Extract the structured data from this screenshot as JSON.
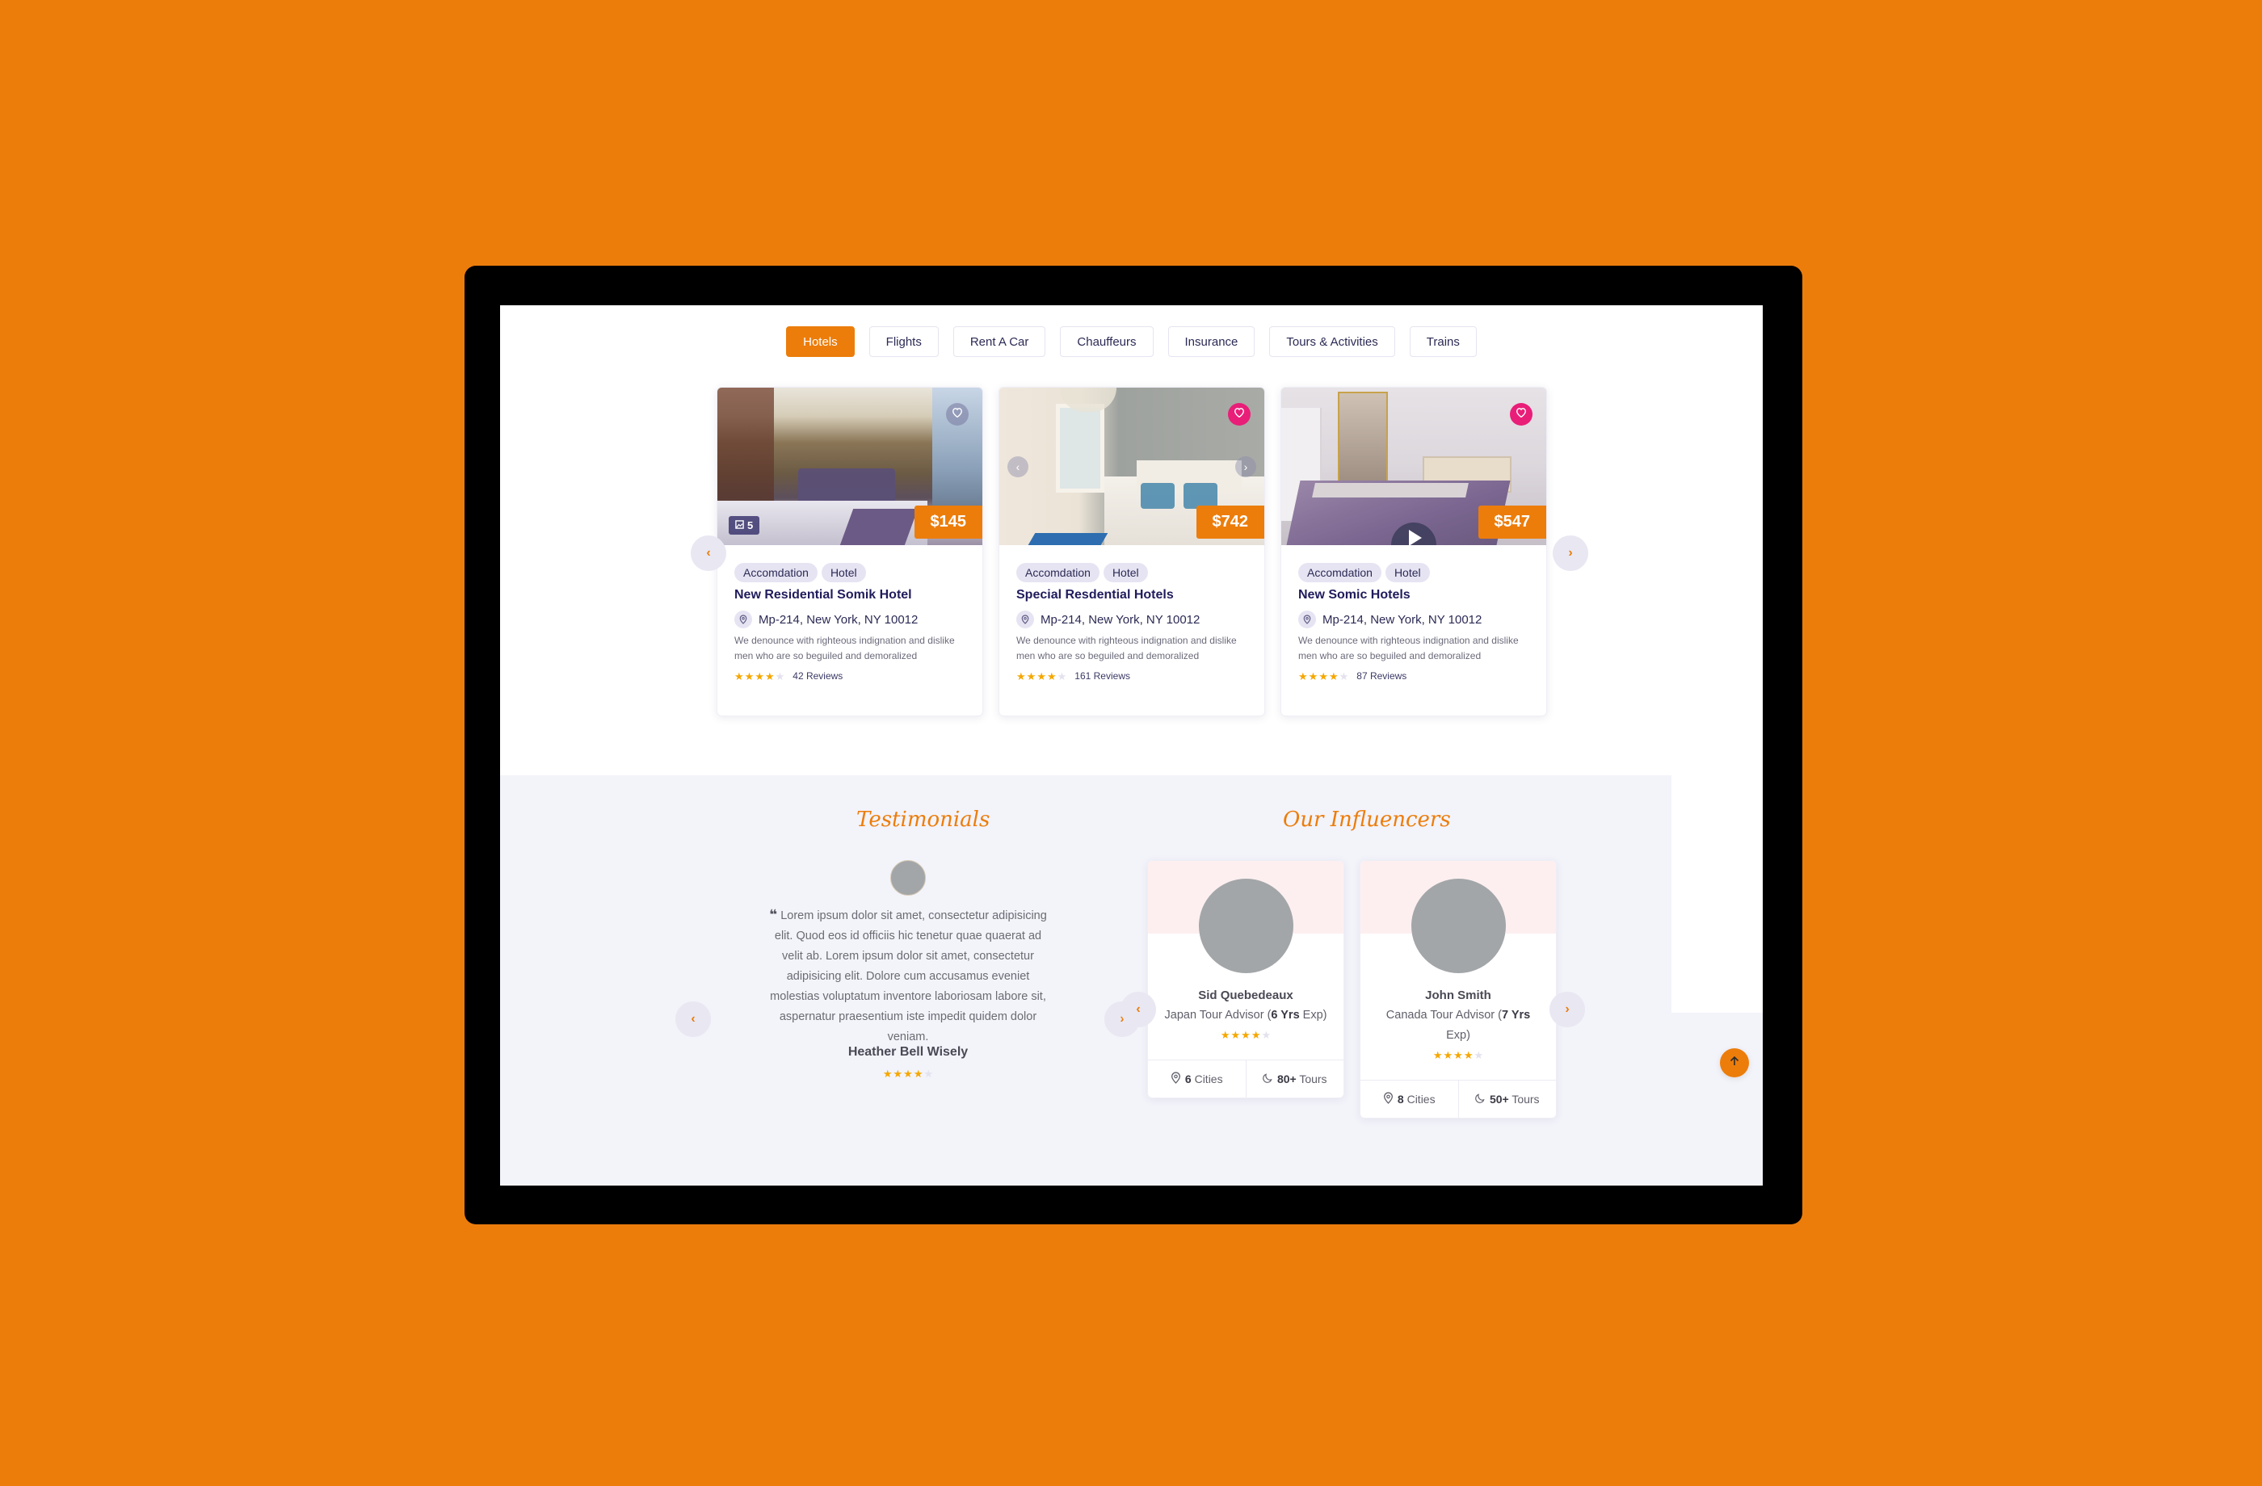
{
  "tabs": [
    {
      "label": "Hotels",
      "active": true
    },
    {
      "label": "Flights",
      "active": false
    },
    {
      "label": "Rent A Car",
      "active": false
    },
    {
      "label": "Chauffeurs",
      "active": false
    },
    {
      "label": "Insurance",
      "active": false
    },
    {
      "label": "Tours & Activities",
      "active": false
    },
    {
      "label": "Trains",
      "active": false
    }
  ],
  "hotels": [
    {
      "price": "$145",
      "chips": [
        "Accomdation",
        "Hotel"
      ],
      "title": "New Residential Somik Hotel",
      "location": "Mp-214, New York, NY 10012",
      "description": "We denounce with righteous indignation and dislike men who are so beguiled and demoralized",
      "rating": 4,
      "rating_max": 5,
      "reviews": "42 Reviews",
      "favorited": false,
      "gallery_count": "5"
    },
    {
      "price": "$742",
      "chips": [
        "Accomdation",
        "Hotel"
      ],
      "title": "Special Resdential Hotels",
      "location": "Mp-214, New York, NY 10012",
      "description": "We denounce with righteous indignation and dislike men who are so beguiled and demoralized",
      "rating": 4,
      "rating_max": 5,
      "reviews": "161 Reviews",
      "favorited": true
    },
    {
      "price": "$547",
      "chips": [
        "Accomdation",
        "Hotel"
      ],
      "title": "New Somic Hotels",
      "location": "Mp-214, New York, NY 10012",
      "description": "We denounce with righteous indignation and dislike men who are so beguiled and demoralized",
      "rating": 4,
      "rating_max": 5,
      "reviews": "87 Reviews",
      "favorited": true
    }
  ],
  "testimonials": {
    "heading": "Testimonials",
    "quote": "Lorem ipsum dolor sit amet, consectetur adipisicing elit. Quod eos id officiis hic tenetur quae quaerat ad velit ab. Lorem ipsum dolor sit amet, consectetur adipisicing elit. Dolore cum accusamus eveniet molestias voluptatum inventore laboriosam labore sit, aspernatur praesentium iste impedit quidem dolor veniam.",
    "author": "Heather Bell Wisely",
    "rating": 4,
    "rating_max": 5
  },
  "influencers": {
    "heading": "Our Influencers",
    "items": [
      {
        "name": "Sid Quebedeaux",
        "role_prefix": "Japan Tour Advisor (",
        "years": "6 Yrs",
        "role_suffix": " Exp)",
        "rating": 4,
        "rating_max": 5,
        "cities_num": "6",
        "cities_label": " Cities",
        "tours_num": "80+",
        "tours_label": " Tours"
      },
      {
        "name": "John Smith",
        "role_prefix": "Canada Tour Advisor (",
        "years": "7 Yrs",
        "role_suffix": " Exp)",
        "rating": 4,
        "rating_max": 5,
        "cities_num": "8",
        "cities_label": " Cities",
        "tours_num": "50+",
        "tours_label": " Tours"
      }
    ]
  },
  "icons": {
    "prev": "‹",
    "next": "›"
  },
  "colors": {
    "accent": "#ec7d0b",
    "favorite": "#e91e78",
    "title": "#201c5c",
    "star": "#f5a700"
  }
}
